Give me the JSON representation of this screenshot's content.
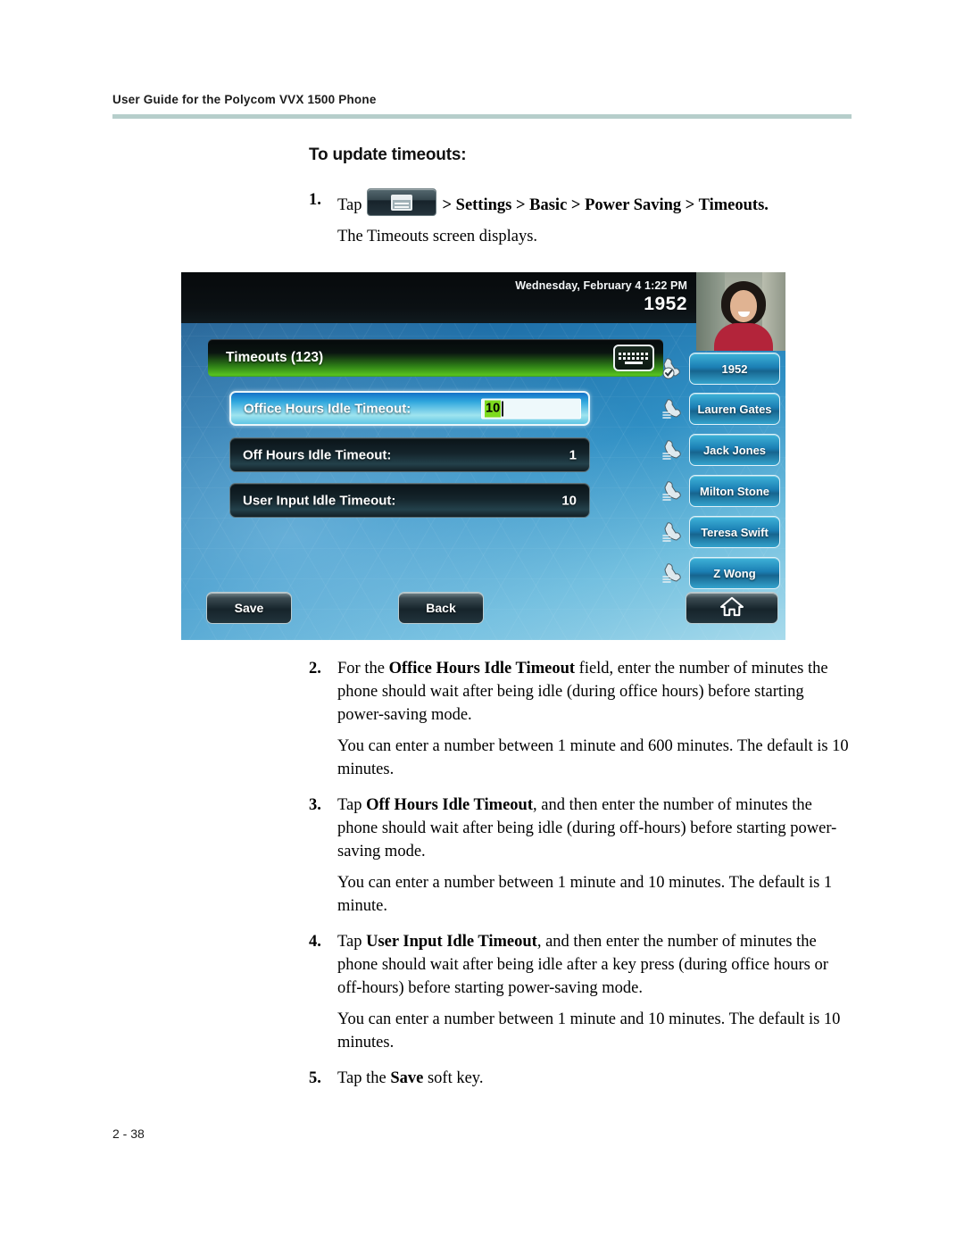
{
  "header": {
    "title": "User Guide for the Polycom VVX 1500 Phone"
  },
  "footer": {
    "page_number": "2 - 38"
  },
  "section": {
    "title": "To update timeouts:"
  },
  "steps": {
    "step1": {
      "number": "1.",
      "tap_label": "Tap",
      "menu_icon_name": "menu-key-icon",
      "path": "> Settings > Basic > Power Saving > Timeouts.",
      "result": "The Timeouts screen displays."
    },
    "step2": {
      "number": "2.",
      "lead": "For the ",
      "bold": "Office Hours Idle Timeout",
      "rest": " field, enter the number of minutes the phone should wait after being idle (during office hours) before starting power-saving mode.",
      "note": "You can enter a number between 1 minute and 600 minutes. The default is 10 minutes."
    },
    "step3": {
      "number": "3.",
      "lead": "Tap ",
      "bold": "Off Hours Idle Timeout",
      "rest": ", and then enter the number of minutes the phone should wait after being idle (during off-hours) before starting power-saving mode.",
      "note": "You can enter a number between 1 minute and 10 minutes. The default is 1 minute."
    },
    "step4": {
      "number": "4.",
      "lead": "Tap ",
      "bold": "User Input Idle Timeout",
      "rest": ", and then enter the number of minutes the phone should wait after being idle after a key press (during office hours or off-hours) before starting power-saving mode.",
      "note": "You can enter a number between 1 minute and 10 minutes. The default is 10 minutes."
    },
    "step5": {
      "number": "5.",
      "lead": "Tap the ",
      "bold": "Save",
      "rest": " soft key."
    }
  },
  "phone_screen": {
    "status": {
      "date_time": "Wednesday, February 4  1:22 PM",
      "extension": "1952"
    },
    "title_bar": {
      "label": "Timeouts (123)",
      "keyboard_icon_name": "keyboard-icon"
    },
    "rows": [
      {
        "label": "Office Hours Idle Timeout:",
        "value": "10",
        "selected": true,
        "editing": true
      },
      {
        "label": "Off Hours Idle Timeout:",
        "value": "1",
        "selected": false,
        "editing": false
      },
      {
        "label": "User Input Idle Timeout:",
        "value": "10",
        "selected": false,
        "editing": false
      }
    ],
    "line_keys": [
      {
        "label": "1952",
        "icon": "handset-registered-icon"
      },
      {
        "label": "Lauren Gates",
        "icon": "handset-icon"
      },
      {
        "label": "Jack Jones",
        "icon": "handset-icon"
      },
      {
        "label": "Milton Stone",
        "icon": "handset-icon"
      },
      {
        "label": "Teresa Swift",
        "icon": "handset-icon"
      },
      {
        "label": "Z Wong",
        "icon": "handset-icon"
      }
    ],
    "soft_keys": [
      {
        "label": "Save",
        "name": "save-soft-key"
      },
      {
        "label": "Back",
        "name": "back-soft-key"
      },
      {
        "label": "",
        "name": "home-soft-key",
        "icon": "home-icon"
      }
    ],
    "colors": {
      "title_bar_green": "#57c320",
      "selected_row_cyan": "#2fa6dd",
      "selection_highlight_green": "#7ddb1e",
      "line_key_blue": "#1b7fb4",
      "header_rule": "#b6cecb"
    }
  }
}
